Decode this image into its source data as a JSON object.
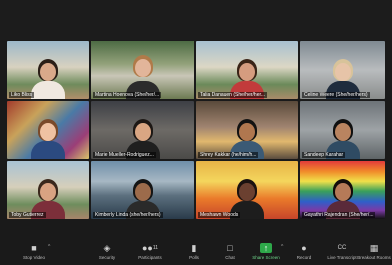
{
  "participants": [
    {
      "name": "Liko Bliss"
    },
    {
      "name": "Martina Hoenova (She/her/..."
    },
    {
      "name": "Talia Danauen (She/her/her..."
    },
    {
      "name": "Celine Weere (She/her/hers)"
    },
    {
      "name": ""
    },
    {
      "name": "Marie Mueller-Rodriguez..."
    },
    {
      "name": "Shrey Kakkar (he/him/h..."
    },
    {
      "name": "Sandeep Karahar"
    },
    {
      "name": "Toby Gutierrez"
    },
    {
      "name": "Kimberly Linda (she/her/hers)"
    },
    {
      "name": "Meshawn Woods"
    },
    {
      "name": "Gayathri Rajendran (She/her/..."
    }
  ],
  "toolbar": {
    "items": [
      {
        "label": "Stop Video",
        "icon": "video-camera-icon"
      },
      {
        "label": "Security",
        "icon": "shield-icon"
      },
      {
        "label": "Participants",
        "icon": "participants-icon",
        "count": "11"
      },
      {
        "label": "Polls",
        "icon": "polls-icon"
      },
      {
        "label": "Chat",
        "icon": "chat-icon"
      },
      {
        "label": "Share Screen",
        "icon": "share-screen-icon"
      },
      {
        "label": "Record",
        "icon": "record-icon"
      },
      {
        "label": "Live Transcript",
        "icon": "cc-icon"
      },
      {
        "label": "Breakout Rooms",
        "icon": "breakout-rooms-icon"
      }
    ]
  },
  "colors": {
    "active_speaker_border": "#c6e06a",
    "share_screen_green": "#2ea84a"
  }
}
